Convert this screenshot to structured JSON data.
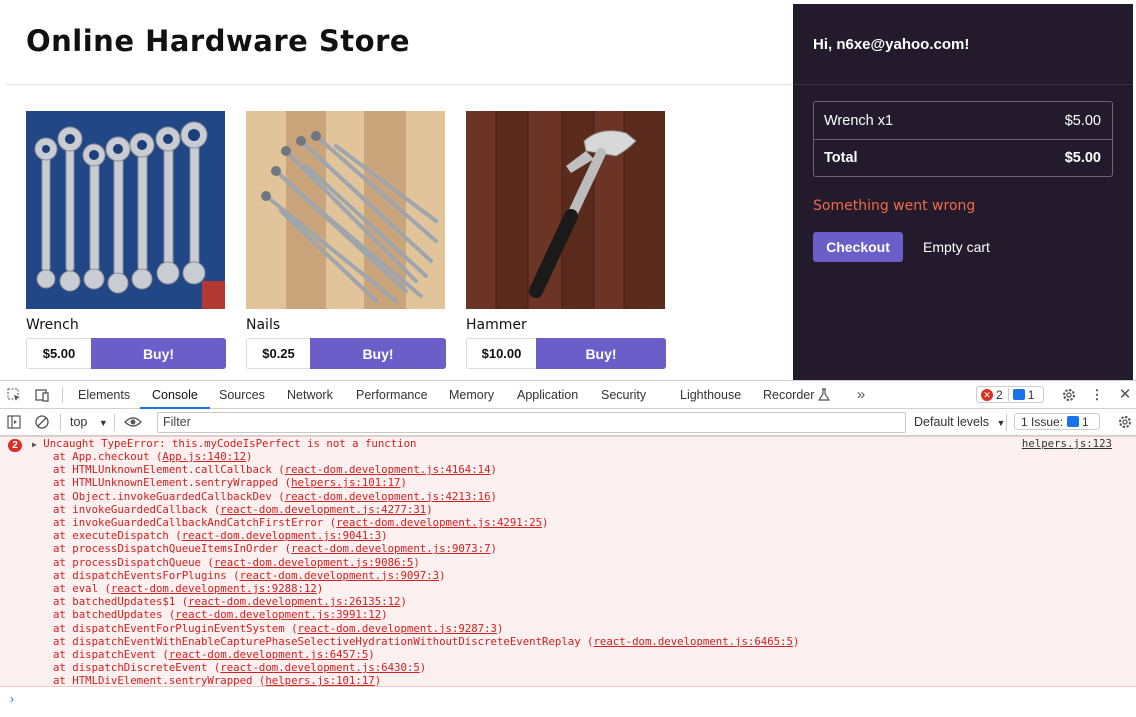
{
  "store": {
    "title": "Online Hardware Store",
    "products": [
      {
        "name": "Wrench",
        "price": "$5.00",
        "buy_label": "Buy!"
      },
      {
        "name": "Nails",
        "price": "$0.25",
        "buy_label": "Buy!"
      },
      {
        "name": "Hammer",
        "price": "$10.00",
        "buy_label": "Buy!"
      }
    ]
  },
  "cart": {
    "greeting": "Hi, n6xe@yahoo.com!",
    "items": [
      {
        "label": "Wrench x1",
        "amount": "$5.00"
      }
    ],
    "total_label": "Total",
    "total_amount": "$5.00",
    "error": "Something went wrong",
    "checkout_label": "Checkout",
    "empty_label": "Empty cart"
  },
  "devtools": {
    "tabs": [
      "Elements",
      "Console",
      "Sources",
      "Network",
      "Performance",
      "Memory",
      "Application",
      "Security",
      "Lighthouse",
      "Recorder"
    ],
    "active_tab": "Console",
    "error_count": "2",
    "message_count": "1",
    "context": "top",
    "filter_placeholder": "Filter",
    "levels": "Default levels",
    "issues": "1 Issue:",
    "issues_count": "1"
  },
  "console": {
    "error_badge": "2",
    "message": "Uncaught TypeError: this.myCodeIsPerfect is not a function",
    "source": "helpers.js:123",
    "stack": [
      {
        "fn": "at App.checkout (",
        "loc": "App.js:140:12"
      },
      {
        "fn": "at HTMLUnknownElement.callCallback (",
        "loc": "react-dom.development.js:4164:14"
      },
      {
        "fn": "at HTMLUnknownElement.sentryWrapped (",
        "loc": "helpers.js:101:17"
      },
      {
        "fn": "at Object.invokeGuardedCallbackDev (",
        "loc": "react-dom.development.js:4213:16"
      },
      {
        "fn": "at invokeGuardedCallback (",
        "loc": "react-dom.development.js:4277:31"
      },
      {
        "fn": "at invokeGuardedCallbackAndCatchFirstError (",
        "loc": "react-dom.development.js:4291:25"
      },
      {
        "fn": "at executeDispatch (",
        "loc": "react-dom.development.js:9041:3"
      },
      {
        "fn": "at processDispatchQueueItemsInOrder (",
        "loc": "react-dom.development.js:9073:7"
      },
      {
        "fn": "at processDispatchQueue (",
        "loc": "react-dom.development.js:9086:5"
      },
      {
        "fn": "at dispatchEventsForPlugins (",
        "loc": "react-dom.development.js:9097:3"
      },
      {
        "fn": "at eval (",
        "loc": "react-dom.development.js:9288:12"
      },
      {
        "fn": "at batchedUpdates$1 (",
        "loc": "react-dom.development.js:26135:12"
      },
      {
        "fn": "at batchedUpdates (",
        "loc": "react-dom.development.js:3991:12"
      },
      {
        "fn": "at dispatchEventForPluginEventSystem (",
        "loc": "react-dom.development.js:9287:3"
      },
      {
        "fn": "at dispatchEventWithEnableCapturePhaseSelectiveHydrationWithoutDiscreteEventReplay (",
        "loc": "react-dom.development.js:6465:5"
      },
      {
        "fn": "at dispatchEvent (",
        "loc": "react-dom.development.js:6457:5"
      },
      {
        "fn": "at dispatchDiscreteEvent (",
        "loc": "react-dom.development.js:6430:5"
      },
      {
        "fn": "at HTMLDivElement.sentryWrapped (",
        "loc": "helpers.js:101:17"
      }
    ]
  },
  "colors": {
    "accent": "#6c5ec8",
    "cart_bg": "#231b2b",
    "error": "#ef6a4c"
  }
}
